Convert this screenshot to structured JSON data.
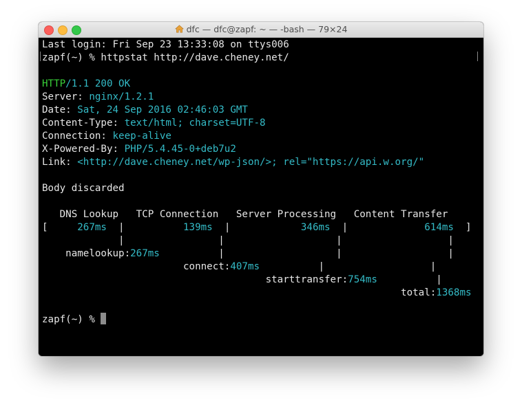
{
  "window": {
    "title": "dfc — dfc@zapf: ~ — -bash — 79×24",
    "close_label": "Close",
    "minimize_label": "Minimize",
    "zoom_label": "Zoom"
  },
  "terminal": {
    "last_login": "Last login: Fri Sep 23 13:33:08 on ttys006",
    "prompt": "zapf(~) % ",
    "command": "httpstat http://dave.cheney.net/",
    "status_proto": "HTTP",
    "status_rest": "/1.1 200 OK",
    "headers": [
      {
        "key": "Server: ",
        "value": "nginx/1.2.1"
      },
      {
        "key": "Date: ",
        "value": "Sat, 24 Sep 2016 02:46:03 GMT"
      },
      {
        "key": "Content-Type: ",
        "value": "text/html; charset=UTF-8"
      },
      {
        "key": "Connection: ",
        "value": "keep-alive"
      },
      {
        "key": "X-Powered-By: ",
        "value": "PHP/5.4.45-0+deb7u2"
      },
      {
        "key": "Link: ",
        "value": "<http://dave.cheney.net/wp-json/>; rel=\"https://api.w.org/\""
      }
    ],
    "body_message": "Body discarded",
    "timing": {
      "header_row": "   DNS Lookup   TCP Connection   Server Processing   Content Transfer",
      "row_open": "[     ",
      "dns": "267ms",
      "sep1": "  |          ",
      "tcp": "139ms",
      "sep2": "  |            ",
      "server": "346ms",
      "sep3": "  |             ",
      "transfer": "614ms",
      "row_close": "  ]",
      "pipes_line": "             |                |                   |                  |",
      "namelookup_pre": "    namelookup:",
      "namelookup_val": "267ms",
      "namelookup_post": "          |                   |                  |",
      "connect_pre": "                        connect:",
      "connect_val": "407ms",
      "connect_post": "          |                  |",
      "starttransfer_pre": "                                      starttransfer:",
      "starttransfer_val": "754ms",
      "starttransfer_post": "          |",
      "total_pre": "                                                             total:",
      "total_val": "1368ms"
    },
    "final_prompt": "zapf(~) % "
  }
}
